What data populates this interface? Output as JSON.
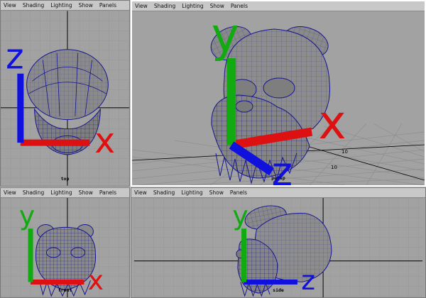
{
  "menu_labels": [
    "View",
    "Shading",
    "Lighting",
    "Show",
    "Panels"
  ],
  "panes": {
    "top": {
      "camera_label": "top",
      "active": false
    },
    "persp": {
      "camera_label": "persp",
      "active": true,
      "grid_labels": [
        "10",
        "10"
      ]
    },
    "front": {
      "camera_label": "front",
      "active": false
    },
    "side": {
      "camera_label": "side",
      "active": false
    }
  },
  "axis_labels": {
    "x": "x",
    "y": "y",
    "z": "z"
  },
  "colors": {
    "mesh_fill": "#8b8b8b",
    "wire": "#16168f",
    "grid": "#909090",
    "axis_line": "#000000",
    "x_axis": "#d11",
    "y_axis": "#1a1",
    "z_axis": "#11d"
  }
}
